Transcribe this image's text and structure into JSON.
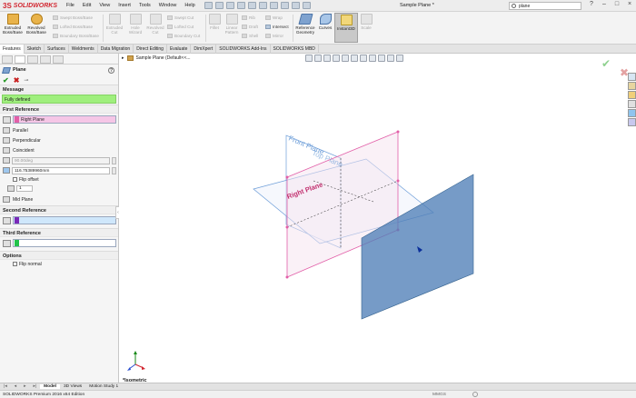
{
  "app": {
    "logo_brand": "SOLIDWORKS",
    "logo_mark": "3S",
    "doc_title": "Sample Plane *",
    "search_value": "plane",
    "menus": [
      "File",
      "Edit",
      "View",
      "Insert",
      "Tools",
      "Window",
      "Help"
    ]
  },
  "ribbon": {
    "extruded_bossbase": "Extruded Boss/Base",
    "revolved_bossbase": "Revolved Boss/Base",
    "swept_bossbase": "Swept Boss/Base",
    "lofted_bossbase": "Lofted Boss/Base",
    "boundary_bossbase": "Boundary Boss/Base",
    "extruded_cut": "Extruded Cut",
    "hole_wizard": "Hole Wizard",
    "revolved_cut": "Revolved Cut",
    "swept_cut": "Swept Cut",
    "lofted_cut": "Lofted Cut",
    "boundary_cut": "Boundary Cut",
    "fillet": "Fillet",
    "linear_pattern": "Linear Pattern",
    "rib": "Rib",
    "draft": "Draft",
    "shell": "Shell",
    "wrap": "Wrap",
    "intersect": "Intersect",
    "mirror": "Mirror",
    "reference_geometry": "Reference Geometry",
    "curves": "Curves",
    "instant3d": "Instant3D",
    "scale": "Scale"
  },
  "tabs": [
    "Features",
    "Sketch",
    "Surfaces",
    "Weldments",
    "Data Migration",
    "Direct Editing",
    "Evaluate",
    "DimXpert",
    "SOLIDWORKS Add-Ins",
    "SOLIDWORKS MBD"
  ],
  "property_manager": {
    "title": "Plane",
    "help": "?",
    "ok": "✔",
    "cancel": "✖",
    "pin": "⊸",
    "message_header": "Message",
    "message": "Fully defined",
    "first_reference_header": "First Reference",
    "first_reference_value": "Right Plane",
    "options_first": {
      "parallel": "Parallel",
      "perpendicular": "Perpendicular",
      "coincident": "Coincident"
    },
    "angle_value": "90.00deg",
    "offset_value": "116.75389960mm",
    "flip_offset": "Flip offset",
    "instances_value": "1",
    "mid_plane": "Mid Plane",
    "second_reference_header": "Second Reference",
    "third_reference_header": "Third Reference",
    "options_header": "Options",
    "flip_normal": "Flip normal"
  },
  "graphics": {
    "breadcrumb": "Sample Plane (Default<<...",
    "view_label": "*Isometric",
    "plane_label_front": "Front Plane",
    "plane_label_top": "Top Plane",
    "plane_label_right": "Right Plane",
    "confirm_ok": "✔",
    "confirm_cancel": "✖"
  },
  "bottom_tabs": [
    "Model",
    "3D Views",
    "Motion Study 1"
  ],
  "status": {
    "text": "SOLIDWORKS Premium 2016 x64 Edition",
    "units": "MMGS"
  },
  "colors": {
    "accent_red": "#d22630",
    "message_green": "#9fef7d",
    "reference_pink": "#f5c6e6",
    "second_ref_color": "#7a29b8",
    "third_ref_color": "#21c34a",
    "new_plane_fill": "#4f7fb7",
    "reference_plane_pink": "#e25fa8",
    "reference_plane_blue": "#6f9fd9"
  }
}
